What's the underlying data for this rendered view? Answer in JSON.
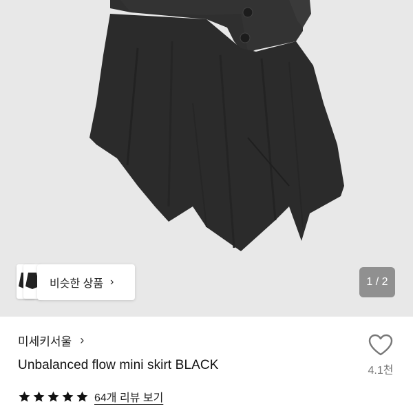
{
  "gallery": {
    "similar_label": "비슷한 상품",
    "page_indicator": "1 / 2"
  },
  "product": {
    "brand": "미세키서울",
    "title": "Unbalanced flow mini skirt BLACK",
    "rating": 5,
    "review_link": "64개 리뷰 보기",
    "like_count": "4.1천"
  },
  "colors": {
    "background": "#e8e8e8",
    "skirt": "#2c2c2c",
    "star": "#111111",
    "muted": "#777777"
  }
}
